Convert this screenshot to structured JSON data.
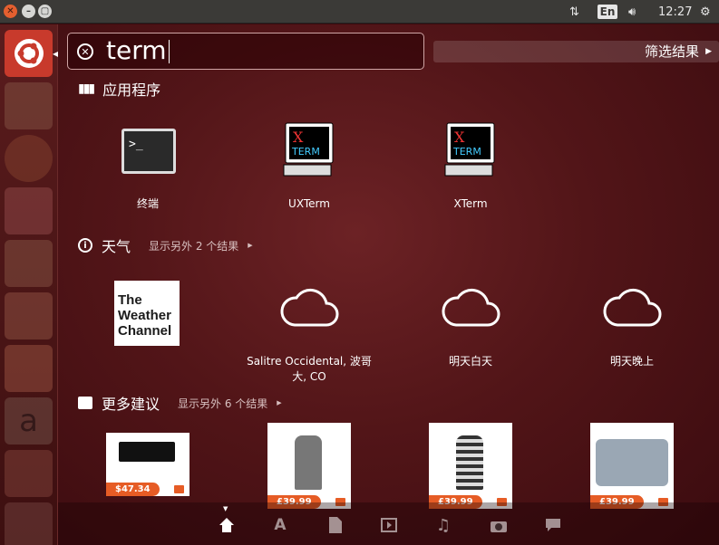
{
  "topbar": {
    "lang": "En",
    "time": "12:27"
  },
  "search": {
    "value": "term"
  },
  "filter": {
    "label": "筛选结果"
  },
  "sections": {
    "apps": {
      "title": "应用程序",
      "items": [
        {
          "label": "终端"
        },
        {
          "label": "UXTerm"
        },
        {
          "label": "XTerm"
        }
      ]
    },
    "weather": {
      "title": "天气",
      "more": "显示另外 2 个结果",
      "brand": [
        "The",
        "Weather",
        "Channel"
      ],
      "items": [
        {
          "label": "Salitre Occidental, 波哥大, CO"
        },
        {
          "label": "明天白天"
        },
        {
          "label": "明天晚上"
        }
      ]
    },
    "suggest": {
      "title": "更多建议",
      "more": "显示另外 6 个结果",
      "prices": [
        "$47.34",
        "£39.99",
        "£39.99",
        "£39.99"
      ]
    }
  },
  "colors": {
    "accent": "#e65c25",
    "dash_bg": "#521518",
    "launcher_active": "#c83a2c"
  }
}
